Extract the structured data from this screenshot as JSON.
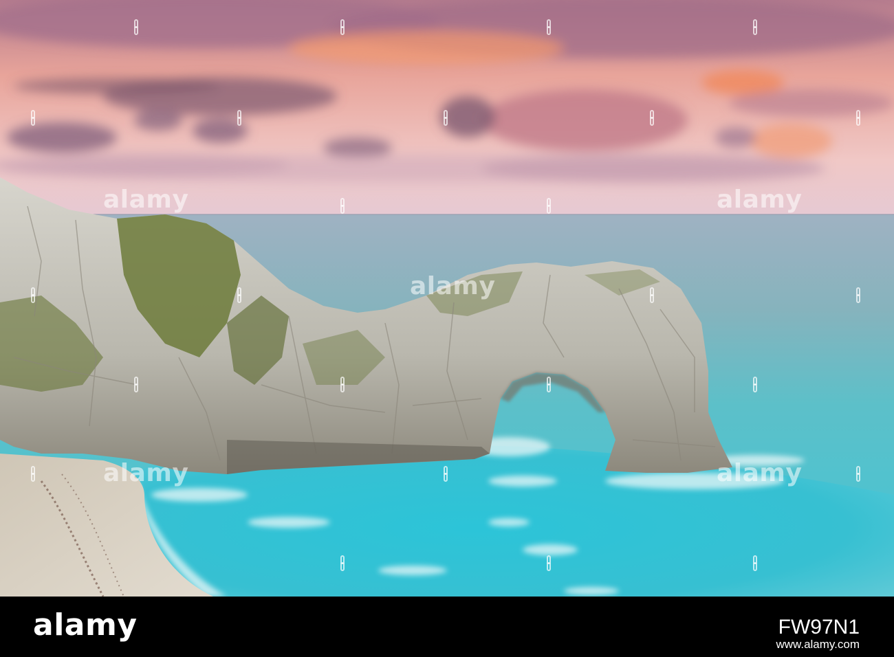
{
  "watermark": {
    "text": "alamy"
  },
  "footer": {
    "logo": "alamy",
    "image_id": "FW97N1",
    "url": "www.alamy.com"
  },
  "colors": {
    "sky_pink": "#e7a7a3",
    "cloud_purple": "#9b7086",
    "sea_turquoise": "#3fc7d3",
    "deep_sea": "#8fb4bf",
    "rock": "#c9c6bd",
    "moss": "#6f7a3c",
    "sand": "#d8d0c3",
    "footer_bg": "#000000"
  }
}
